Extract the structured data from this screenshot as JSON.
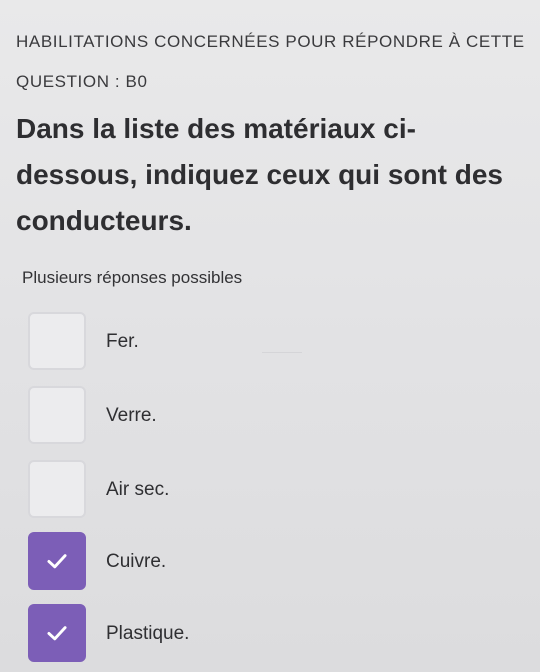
{
  "header": {
    "habilitations": "HABILITATIONS CONCERNÉES POUR RÉPONDRE À CETTE QUESTION : B0"
  },
  "question": {
    "text": "Dans la liste des matériaux ci-dessous, indiquez ceux qui sont des conducteurs."
  },
  "hint": {
    "text": "Plusieurs réponses possibles"
  },
  "options": [
    {
      "label": "Fer.",
      "checked": false
    },
    {
      "label": "Verre.",
      "checked": false
    },
    {
      "label": "Air sec.",
      "checked": false
    },
    {
      "label": "Cuivre.",
      "checked": true
    },
    {
      "label": "Plastique.",
      "checked": true
    }
  ],
  "colors": {
    "checked_background": "#7c5eb7",
    "unchecked_background": "#ececee",
    "check_mark": "#ffffff"
  },
  "icons": {
    "checked": "checkmark-icon"
  }
}
